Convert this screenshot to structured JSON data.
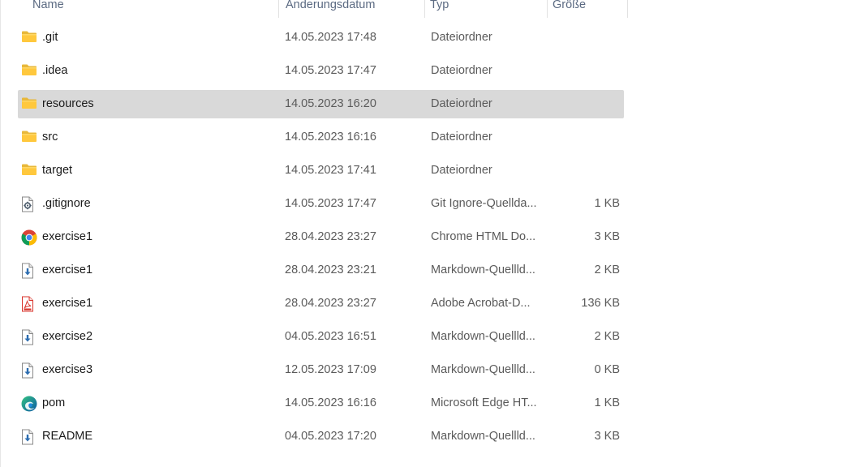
{
  "columns": {
    "name": "Name",
    "date": "Änderungsdatum",
    "type": "Typ",
    "size": "Größe"
  },
  "rows": [
    {
      "name": ".git",
      "date": "14.05.2023 17:48",
      "type": "Dateiordner",
      "size": "",
      "icon": "folder-icon",
      "selected": false
    },
    {
      "name": ".idea",
      "date": "14.05.2023 17:47",
      "type": "Dateiordner",
      "size": "",
      "icon": "folder-icon",
      "selected": false
    },
    {
      "name": "resources",
      "date": "14.05.2023 16:20",
      "type": "Dateiordner",
      "size": "",
      "icon": "folder-icon",
      "selected": true
    },
    {
      "name": "src",
      "date": "14.05.2023 16:16",
      "type": "Dateiordner",
      "size": "",
      "icon": "folder-icon",
      "selected": false
    },
    {
      "name": "target",
      "date": "14.05.2023 17:41",
      "type": "Dateiordner",
      "size": "",
      "icon": "folder-icon",
      "selected": false
    },
    {
      "name": ".gitignore",
      "date": "14.05.2023 17:47",
      "type": "Git Ignore-Quellda...",
      "size": "1 KB",
      "icon": "settings-file-icon",
      "selected": false
    },
    {
      "name": "exercise1",
      "date": "28.04.2023 23:27",
      "type": "Chrome HTML Do...",
      "size": "3 KB",
      "icon": "chrome-icon",
      "selected": false
    },
    {
      "name": "exercise1",
      "date": "28.04.2023 23:21",
      "type": "Markdown-Quellld...",
      "size": "2 KB",
      "icon": "markdown-file-icon",
      "selected": false
    },
    {
      "name": "exercise1",
      "date": "28.04.2023 23:27",
      "type": "Adobe Acrobat-D...",
      "size": "136 KB",
      "icon": "pdf-icon",
      "selected": false
    },
    {
      "name": "exercise2",
      "date": "04.05.2023 16:51",
      "type": "Markdown-Quellld...",
      "size": "2 KB",
      "icon": "markdown-file-icon",
      "selected": false
    },
    {
      "name": "exercise3",
      "date": "12.05.2023 17:09",
      "type": "Markdown-Quellld...",
      "size": "0 KB",
      "icon": "markdown-file-icon",
      "selected": false
    },
    {
      "name": "pom",
      "date": "14.05.2023 16:16",
      "type": "Microsoft Edge HT...",
      "size": "1 KB",
      "icon": "edge-icon",
      "selected": false
    },
    {
      "name": "README",
      "date": "04.05.2023 17:20",
      "type": "Markdown-Quellld...",
      "size": "3 KB",
      "icon": "markdown-file-icon",
      "selected": false
    }
  ]
}
